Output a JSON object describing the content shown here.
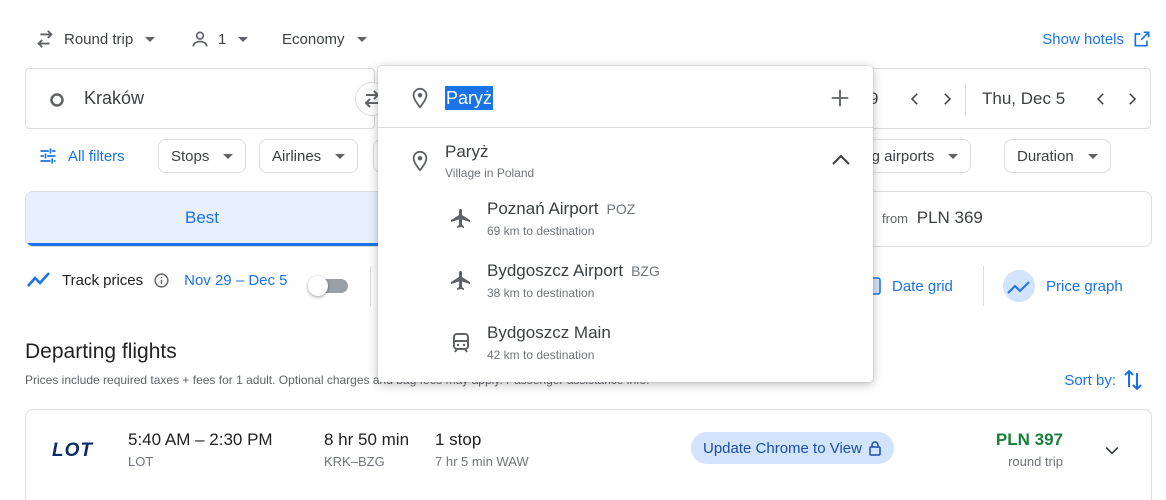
{
  "top_bar": {
    "trip_type": "Round trip",
    "passengers": "1",
    "cabin_class": "Economy",
    "show_hotels": "Show hotels"
  },
  "search": {
    "origin": "Kraków",
    "depart_date_partial": "9",
    "return_date": "Thu, Dec 5"
  },
  "filters": {
    "all_filters": "All filters",
    "chips": [
      "Stops",
      "Airlines",
      "ing airports",
      "Duration"
    ]
  },
  "tabs": {
    "best": "Best",
    "cheapest_prefix": "from",
    "cheapest_price": "PLN 369"
  },
  "tracking": {
    "label": "Track prices",
    "date_range": "Nov 29 – Dec 5",
    "date_grid": "Date grid",
    "price_graph": "Price graph"
  },
  "departing": {
    "title": "Departing flights",
    "subtitle": "Prices include required taxes + fees for 1 adult. Optional charges and bag fees may apply. Passenger assistance info.",
    "sort_label": "Sort by:"
  },
  "flight": {
    "airline_logo": "LOT",
    "time_range": "5:40 AM – 2:30 PM",
    "airline": "LOT",
    "duration": "8 hr 50 min",
    "route": "KRK–BZG",
    "stops": "1 stop",
    "layover": "7 hr 5 min WAW",
    "update_notice": "Update Chrome to View",
    "price": "PLN 397",
    "price_note": "round trip"
  },
  "destination_dropdown": {
    "input_value": "Paryż",
    "place": {
      "name": "Paryż",
      "description": "Village in Poland"
    },
    "options": [
      {
        "name": "Poznań Airport",
        "code": "POZ",
        "distance": "69 km to destination"
      },
      {
        "name": "Bydgoszcz Airport",
        "code": "BZG",
        "distance": "38 km to destination"
      },
      {
        "name": "Bydgoszcz Main",
        "code": "",
        "distance": "42 km to destination"
      }
    ]
  },
  "colors": {
    "accent": "#1a73e8",
    "price_green": "#188038",
    "border": "#dadce0"
  }
}
